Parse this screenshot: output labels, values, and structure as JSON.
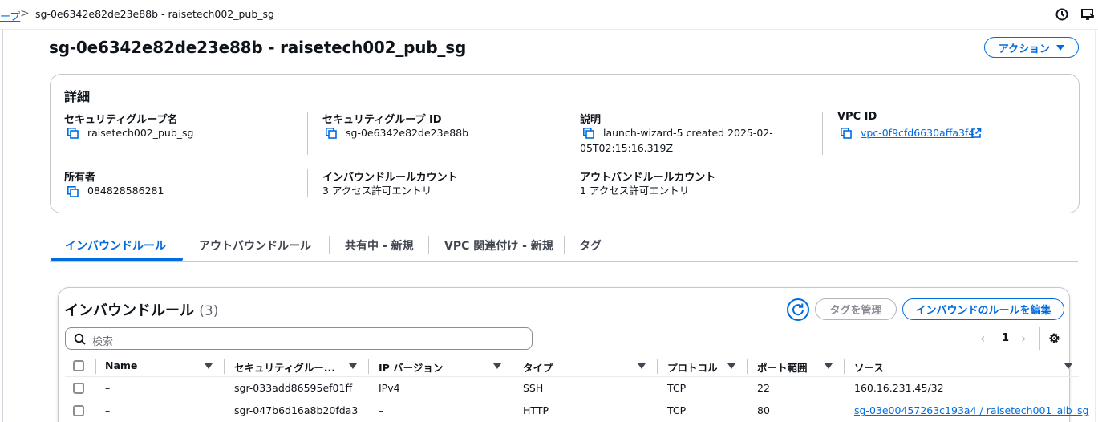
{
  "breadcrumb": {
    "prev": "ープ",
    "separator": ">",
    "current": "sg-0e6342e82de23e88b - raisetech002_pub_sg"
  },
  "header": {
    "title": "sg-0e6342e82de23e88b - raisetech002_pub_sg",
    "action_label": "アクション"
  },
  "details": {
    "heading": "詳細",
    "sg_name_label": "セキュリティグループ名",
    "sg_name_value": "raisetech002_pub_sg",
    "sg_id_label": "セキュリティグループ ID",
    "sg_id_value": "sg-0e6342e82de23e88b",
    "desc_label": "説明",
    "desc_value_line1": "launch-wizard-5 created 2025-02-",
    "desc_value_line2": "05T02:15:16.319Z",
    "vpc_label": "VPC ID",
    "vpc_value": "vpc-0f9cfd6630affa3f4",
    "owner_label": "所有者",
    "owner_value": "084828586281",
    "inbound_count_label": "インバウンドルールカウント",
    "inbound_count_value": "3 アクセス許可エントリ",
    "outbound_count_label": "アウトバンドルールカウント",
    "outbound_count_value": "1 アクセス許可エントリ"
  },
  "tabs": [
    "インバウンドルール",
    "アウトバウンドルール",
    "共有中 - 新規",
    "VPC 関連付け - 新規",
    "タグ"
  ],
  "table": {
    "title": "インバウンドルール",
    "count": "(3)",
    "manage_tags": "タグを管理",
    "edit_rules": "インバウンドのルールを編集",
    "search_placeholder": "検索",
    "page": "1",
    "columns": [
      "Name",
      "セキュリティグルー...",
      "IP バージョン",
      "タイプ",
      "プロトコル",
      "ポート範囲",
      "ソース"
    ],
    "rows": [
      {
        "name": "–",
        "rule_id": "sgr-033add86595ef01ff",
        "ip_version": "IPv4",
        "type": "SSH",
        "protocol": "TCP",
        "port": "22",
        "source": "160.16.231.45/32"
      },
      {
        "name": "–",
        "rule_id": "sgr-047b6d16a8b20fda3",
        "ip_version": "–",
        "type": "HTTP",
        "protocol": "TCP",
        "port": "80",
        "source": "sg-03e00457263c193a4 / raisetech001_alb_sg"
      }
    ]
  },
  "colors": {
    "accent": "#006ce0",
    "border": "#c6c6cd",
    "text": "#0f141a"
  }
}
